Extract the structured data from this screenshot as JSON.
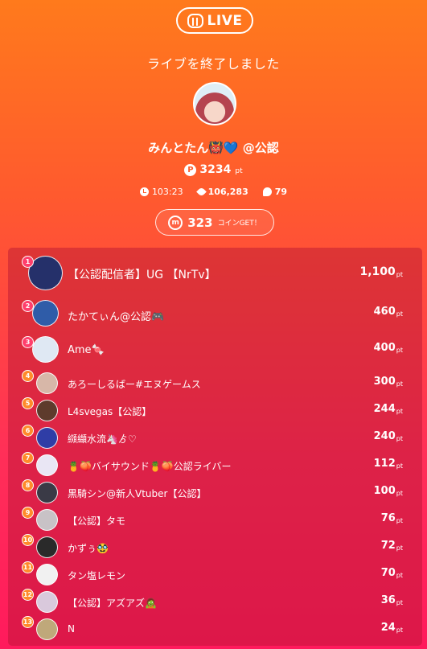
{
  "header": {
    "live_label": "LIVE",
    "ended_title": "ライブを終了しました",
    "host_name": "みんとたん👹💙 @公認",
    "points_icon": "P",
    "points_value": "3234",
    "points_unit": "pt",
    "stats": {
      "duration": "103:23",
      "viewers": "106,283",
      "comments": "79"
    },
    "coin": {
      "icon": "m",
      "amount": "323",
      "label": "コインGET！"
    }
  },
  "ranking": [
    {
      "rank": "1",
      "name": "【公認配信者】UG 【NrTv】",
      "points": "1,100",
      "unit": "pt",
      "avatar_color": "#25306a"
    },
    {
      "rank": "2",
      "name": "たかてぃん@公認🎮",
      "points": "460",
      "unit": "pt",
      "avatar_color": "#2f5ca8"
    },
    {
      "rank": "3",
      "name": "Ame🍬",
      "points": "400",
      "unit": "pt",
      "avatar_color": "#dfe8f3"
    },
    {
      "rank": "4",
      "name": "あろーしるばー#エヌゲームス",
      "points": "300",
      "unit": "pt",
      "avatar_color": "#d7b7a8"
    },
    {
      "rank": "5",
      "name": "L4svegas【公認】",
      "points": "244",
      "unit": "pt",
      "avatar_color": "#5e3b2c"
    },
    {
      "rank": "6",
      "name": "纐纈水流🦄ゟ♡",
      "points": "240",
      "unit": "pt",
      "avatar_color": "#2f3da6"
    },
    {
      "rank": "7",
      "name": "🍍🍑バイサウンド🍍🍑公認ライバー",
      "points": "112",
      "unit": "pt",
      "avatar_color": "#e9e6f4"
    },
    {
      "rank": "8",
      "name": "黒騎シン@新人Vtuber【公認】",
      "points": "100",
      "unit": "pt",
      "avatar_color": "#3a3a46"
    },
    {
      "rank": "9",
      "name": "【公認】タモ",
      "points": "76",
      "unit": "pt",
      "avatar_color": "#c8c2c6"
    },
    {
      "rank": "10",
      "name": "かずぅ🥸",
      "points": "72",
      "unit": "pt",
      "avatar_color": "#2a2a2a"
    },
    {
      "rank": "11",
      "name": "タン塩レモン",
      "points": "70",
      "unit": "pt",
      "avatar_color": "#f1f1f1"
    },
    {
      "rank": "12",
      "name": "【公認】アズアズ🧟",
      "points": "36",
      "unit": "pt",
      "avatar_color": "#d9c9dc"
    },
    {
      "rank": "13",
      "name": "N",
      "points": "24",
      "unit": "pt",
      "avatar_color": "#bfa87a"
    }
  ]
}
